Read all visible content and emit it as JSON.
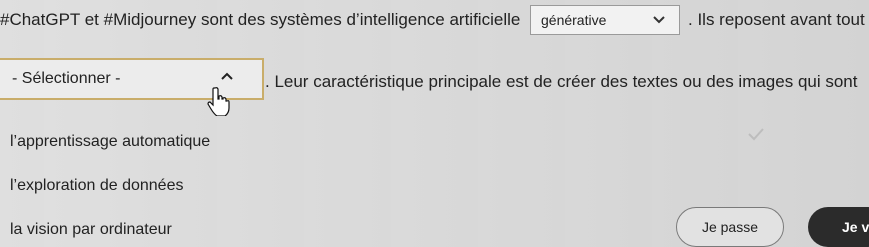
{
  "sentence": {
    "before_blank_1": "#ChatGPT et #Midjourney sont des systèmes d’intelligence artificielle",
    "after_blank_1": ". Ils reposent avant tout sur",
    "after_blank_2": ". Leur caractéristique principale est de créer des textes ou des images qui sont"
  },
  "dropdown_1": {
    "selected": "générative",
    "icon": "chevron-down-icon"
  },
  "dropdown_2": {
    "selected": "- Sélectionner -",
    "icon": "chevron-up-icon",
    "options": [
      "l’apprentissage automatique",
      "l’exploration de données",
      "la vision par ordinateur"
    ]
  },
  "buttons": {
    "skip": "Je passe",
    "next": "Je va"
  },
  "colors": {
    "focus_border": "#c9ad6a",
    "primary_button": "#2b2b2b"
  }
}
